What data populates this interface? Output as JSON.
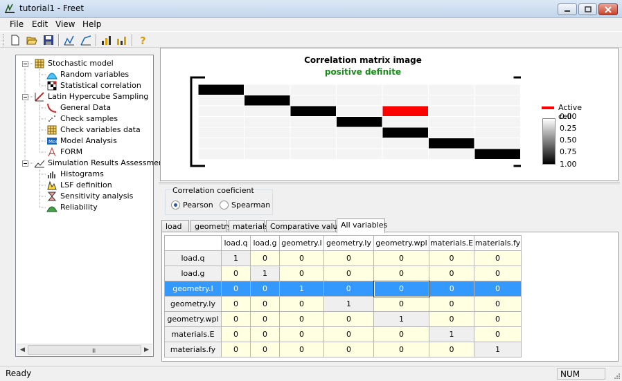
{
  "window": {
    "title": "tutorial1 - Freet"
  },
  "menu": [
    "File",
    "Edit",
    "View",
    "Help"
  ],
  "toolbar_icons": [
    "new-icon",
    "open-icon",
    "save-icon",
    "analysis-icon",
    "analysis2-icon",
    "chart-icon",
    "chart2-icon",
    "help-icon"
  ],
  "tree": [
    {
      "label": "Stochastic model",
      "level": 0,
      "icon": "grid-icon"
    },
    {
      "label": "Random variables",
      "level": 1,
      "icon": "distribution-icon"
    },
    {
      "label": "Statistical correlation",
      "level": 1,
      "icon": "correlation-icon"
    },
    {
      "label": "Latin Hypercube Sampling",
      "level": 0,
      "icon": "lhs-icon"
    },
    {
      "label": "General Data",
      "level": 1,
      "icon": "curve-icon"
    },
    {
      "label": "Check samples",
      "level": 1,
      "icon": "scatter-icon"
    },
    {
      "label": "Check variables data",
      "level": 1,
      "icon": "grid-icon"
    },
    {
      "label": "Model Analysis",
      "level": 1,
      "icon": "model-icon"
    },
    {
      "label": "FORM",
      "level": 1,
      "icon": "form-icon"
    },
    {
      "label": "Simulation Results Assessment",
      "level": 0,
      "icon": "results-icon"
    },
    {
      "label": "Histograms",
      "level": 1,
      "icon": "histogram-icon"
    },
    {
      "label": "LSF definition",
      "level": 1,
      "icon": "lsf-icon"
    },
    {
      "label": "Sensitivity analysis",
      "level": 1,
      "icon": "sensitivity-icon"
    },
    {
      "label": "Reliability",
      "level": 1,
      "icon": "reliability-icon"
    }
  ],
  "corr_image": {
    "title": "Correlation matrix image",
    "subtitle": "positive definite",
    "active_cell_label": "Active cell",
    "scale_labels": [
      "0.00",
      "0.25",
      "0.50",
      "0.75",
      "1.00"
    ],
    "active_color": "#ff0000",
    "active_cell": {
      "row": 2,
      "col": 4
    }
  },
  "coef_group": {
    "label": "Correlation coeficient",
    "options": [
      "Pearson",
      "Spearman"
    ],
    "selected": "Pearson"
  },
  "tabs": [
    "load",
    "geometry",
    "materials",
    "Comparative values",
    "All variables"
  ],
  "active_tab": "All variables",
  "grid": {
    "columns": [
      "load.q",
      "load.g",
      "geometry.I",
      "geometry.Iy",
      "geometry.wpl",
      "materials.E",
      "materials.fy"
    ],
    "rows": [
      {
        "name": "load.q",
        "values": [
          "1",
          "0",
          "0",
          "0",
          "0",
          "0",
          "0"
        ]
      },
      {
        "name": "load.g",
        "values": [
          "0",
          "1",
          "0",
          "0",
          "0",
          "0",
          "0"
        ]
      },
      {
        "name": "geometry.I",
        "values": [
          "0",
          "0",
          "1",
          "0",
          "0",
          "0",
          "0"
        ]
      },
      {
        "name": "geometry.Iy",
        "values": [
          "0",
          "0",
          "0",
          "1",
          "0",
          "0",
          "0"
        ]
      },
      {
        "name": "geometry.wpl",
        "values": [
          "0",
          "0",
          "0",
          "0",
          "1",
          "0",
          "0"
        ]
      },
      {
        "name": "materials.E",
        "values": [
          "0",
          "0",
          "0",
          "0",
          "0",
          "1",
          "0"
        ]
      },
      {
        "name": "materials.fy",
        "values": [
          "0",
          "0",
          "0",
          "0",
          "0",
          "0",
          "1"
        ]
      }
    ],
    "selected_row": 2,
    "focus_col": 4
  },
  "status": {
    "text": "Ready",
    "num": "NUM"
  },
  "scroll_grip": "III"
}
